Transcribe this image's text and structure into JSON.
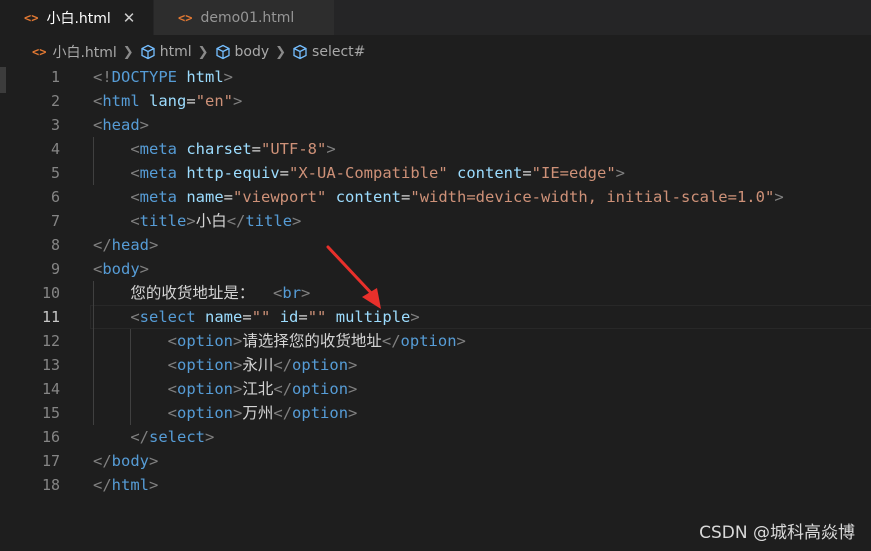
{
  "tabs": [
    {
      "label": "小白.html",
      "active": true
    },
    {
      "label": "demo01.html",
      "active": false
    }
  ],
  "tab_close_glyph": "✕",
  "breadcrumb": {
    "file": "小白.html",
    "items": [
      "html",
      "body",
      "select#"
    ]
  },
  "editor": {
    "current_line": 11,
    "lines": [
      {
        "n": "1"
      },
      {
        "n": "2"
      },
      {
        "n": "3"
      },
      {
        "n": "4"
      },
      {
        "n": "5"
      },
      {
        "n": "6"
      },
      {
        "n": "7"
      },
      {
        "n": "8"
      },
      {
        "n": "9"
      },
      {
        "n": "10"
      },
      {
        "n": "11"
      },
      {
        "n": "12"
      },
      {
        "n": "13"
      },
      {
        "n": "14"
      },
      {
        "n": "15"
      },
      {
        "n": "16"
      },
      {
        "n": "17"
      },
      {
        "n": "18"
      }
    ],
    "tokens": {
      "doctype_open": "<!",
      "doctype_kw": "DOCTYPE",
      "doctype_html": "html",
      "gt": ">",
      "lt": "<",
      "lt_slash": "</",
      "html": "html",
      "lang": "lang",
      "eq": "=",
      "en": "\"en\"",
      "head": "head",
      "meta": "meta",
      "charset": "charset",
      "utf8": "\"UTF-8\"",
      "http_equiv": "http-equiv",
      "xua": "\"X-UA-Compatible\"",
      "content": "content",
      "ie_edge": "\"IE=edge\"",
      "name": "name",
      "viewport": "\"viewport\"",
      "viewport_content": "\"width=device-width, initial-scale=1.0\"",
      "title": "title",
      "title_text": "小白",
      "body": "body",
      "address_text": "您的收货地址是：",
      "br": "br",
      "select": "select",
      "empty_str": "\"\"",
      "id": "id",
      "multiple": "multiple",
      "option": "option",
      "opt1": "请选择您的收货地址",
      "opt2": "永川",
      "opt3": "江北",
      "opt4": "万州"
    }
  },
  "watermark": "CSDN @城科高焱博",
  "colors": {
    "background": "#1e1e1e",
    "tag": "#569cd6",
    "attribute": "#9cdcfe",
    "string": "#ce9178",
    "bracket": "#808080",
    "annotation_arrow": "#e8302b"
  },
  "annotation": {
    "type": "arrow",
    "points_to": "multiple"
  }
}
